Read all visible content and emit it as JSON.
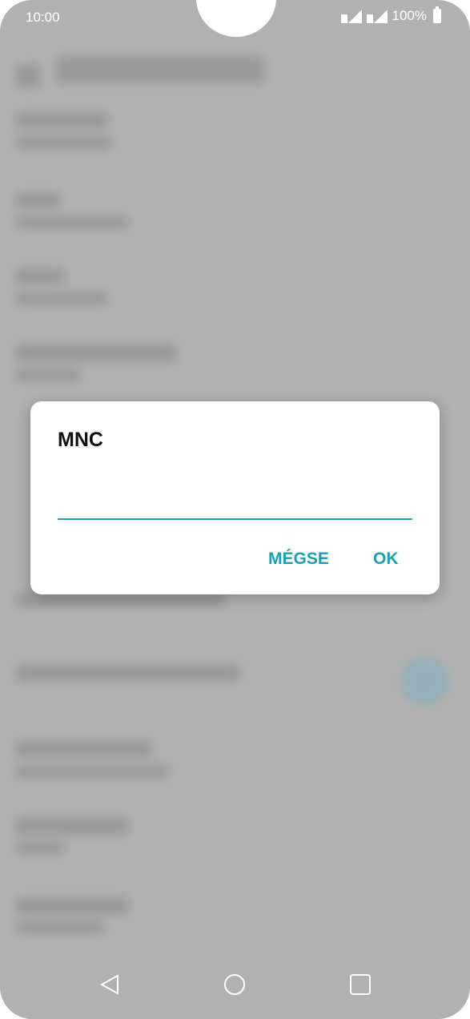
{
  "status_bar": {
    "time": "10:00",
    "battery_percent": "100%"
  },
  "dialog": {
    "title": "MNC",
    "input": {
      "value": "",
      "placeholder": ""
    },
    "cancel_label": "MÉGSE",
    "ok_label": "OK"
  },
  "nav_bar": {
    "back_icon": "triangle-back-icon",
    "home_icon": "circle-home-icon",
    "recent_icon": "square-recent-icon"
  },
  "colors": {
    "accent": "#1a9fb5",
    "scrim": "#b1b1b1",
    "dialog_bg": "#ffffff"
  }
}
